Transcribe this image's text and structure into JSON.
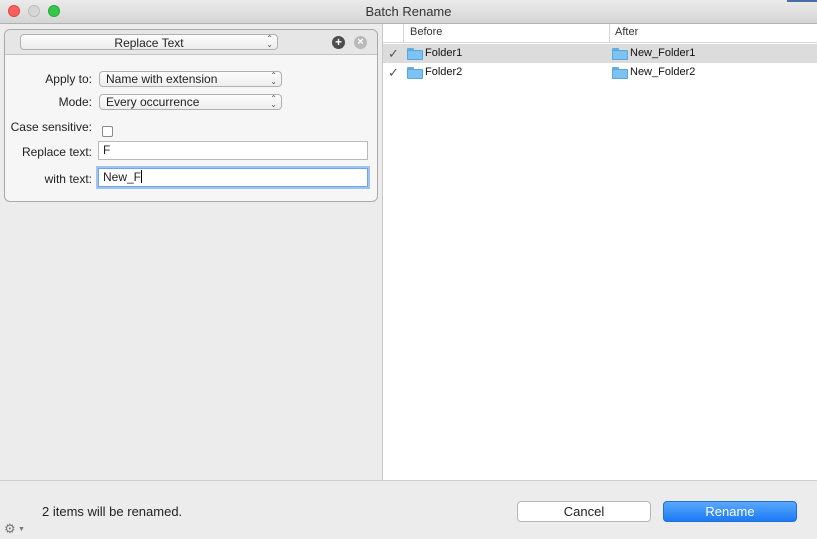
{
  "window": {
    "title": "Batch Rename"
  },
  "rule": {
    "type": "Replace Text",
    "add_symbol": "+",
    "remove_symbol": "×",
    "updown_symbol": "⌃⌄"
  },
  "form": {
    "apply_to_label": "Apply to:",
    "apply_to_value": "Name with extension",
    "mode_label": "Mode:",
    "mode_value": "Every occurrence",
    "case_sensitive_label": "Case sensitive:",
    "case_sensitive_checked": false,
    "replace_text_label": "Replace text:",
    "replace_text_value": "F",
    "with_text_label": "with text:",
    "with_text_value": "New_F"
  },
  "table": {
    "columns": {
      "before": "Before",
      "after": "After"
    },
    "rows": [
      {
        "checked": true,
        "before": "Folder1",
        "after": "New_Folder1",
        "selected": true
      },
      {
        "checked": true,
        "before": "Folder2",
        "after": "New_Folder2",
        "selected": false
      }
    ],
    "check_glyph": "✓"
  },
  "footer": {
    "status": "2 items will be renamed.",
    "cancel_label": "Cancel",
    "rename_label": "Rename",
    "gear_glyph": "⚙",
    "gear_arrow": "▼"
  },
  "colors": {
    "accent": "#1b7bf5",
    "folder": "#7cc3f2",
    "focus_ring": "#9fc4f3"
  }
}
